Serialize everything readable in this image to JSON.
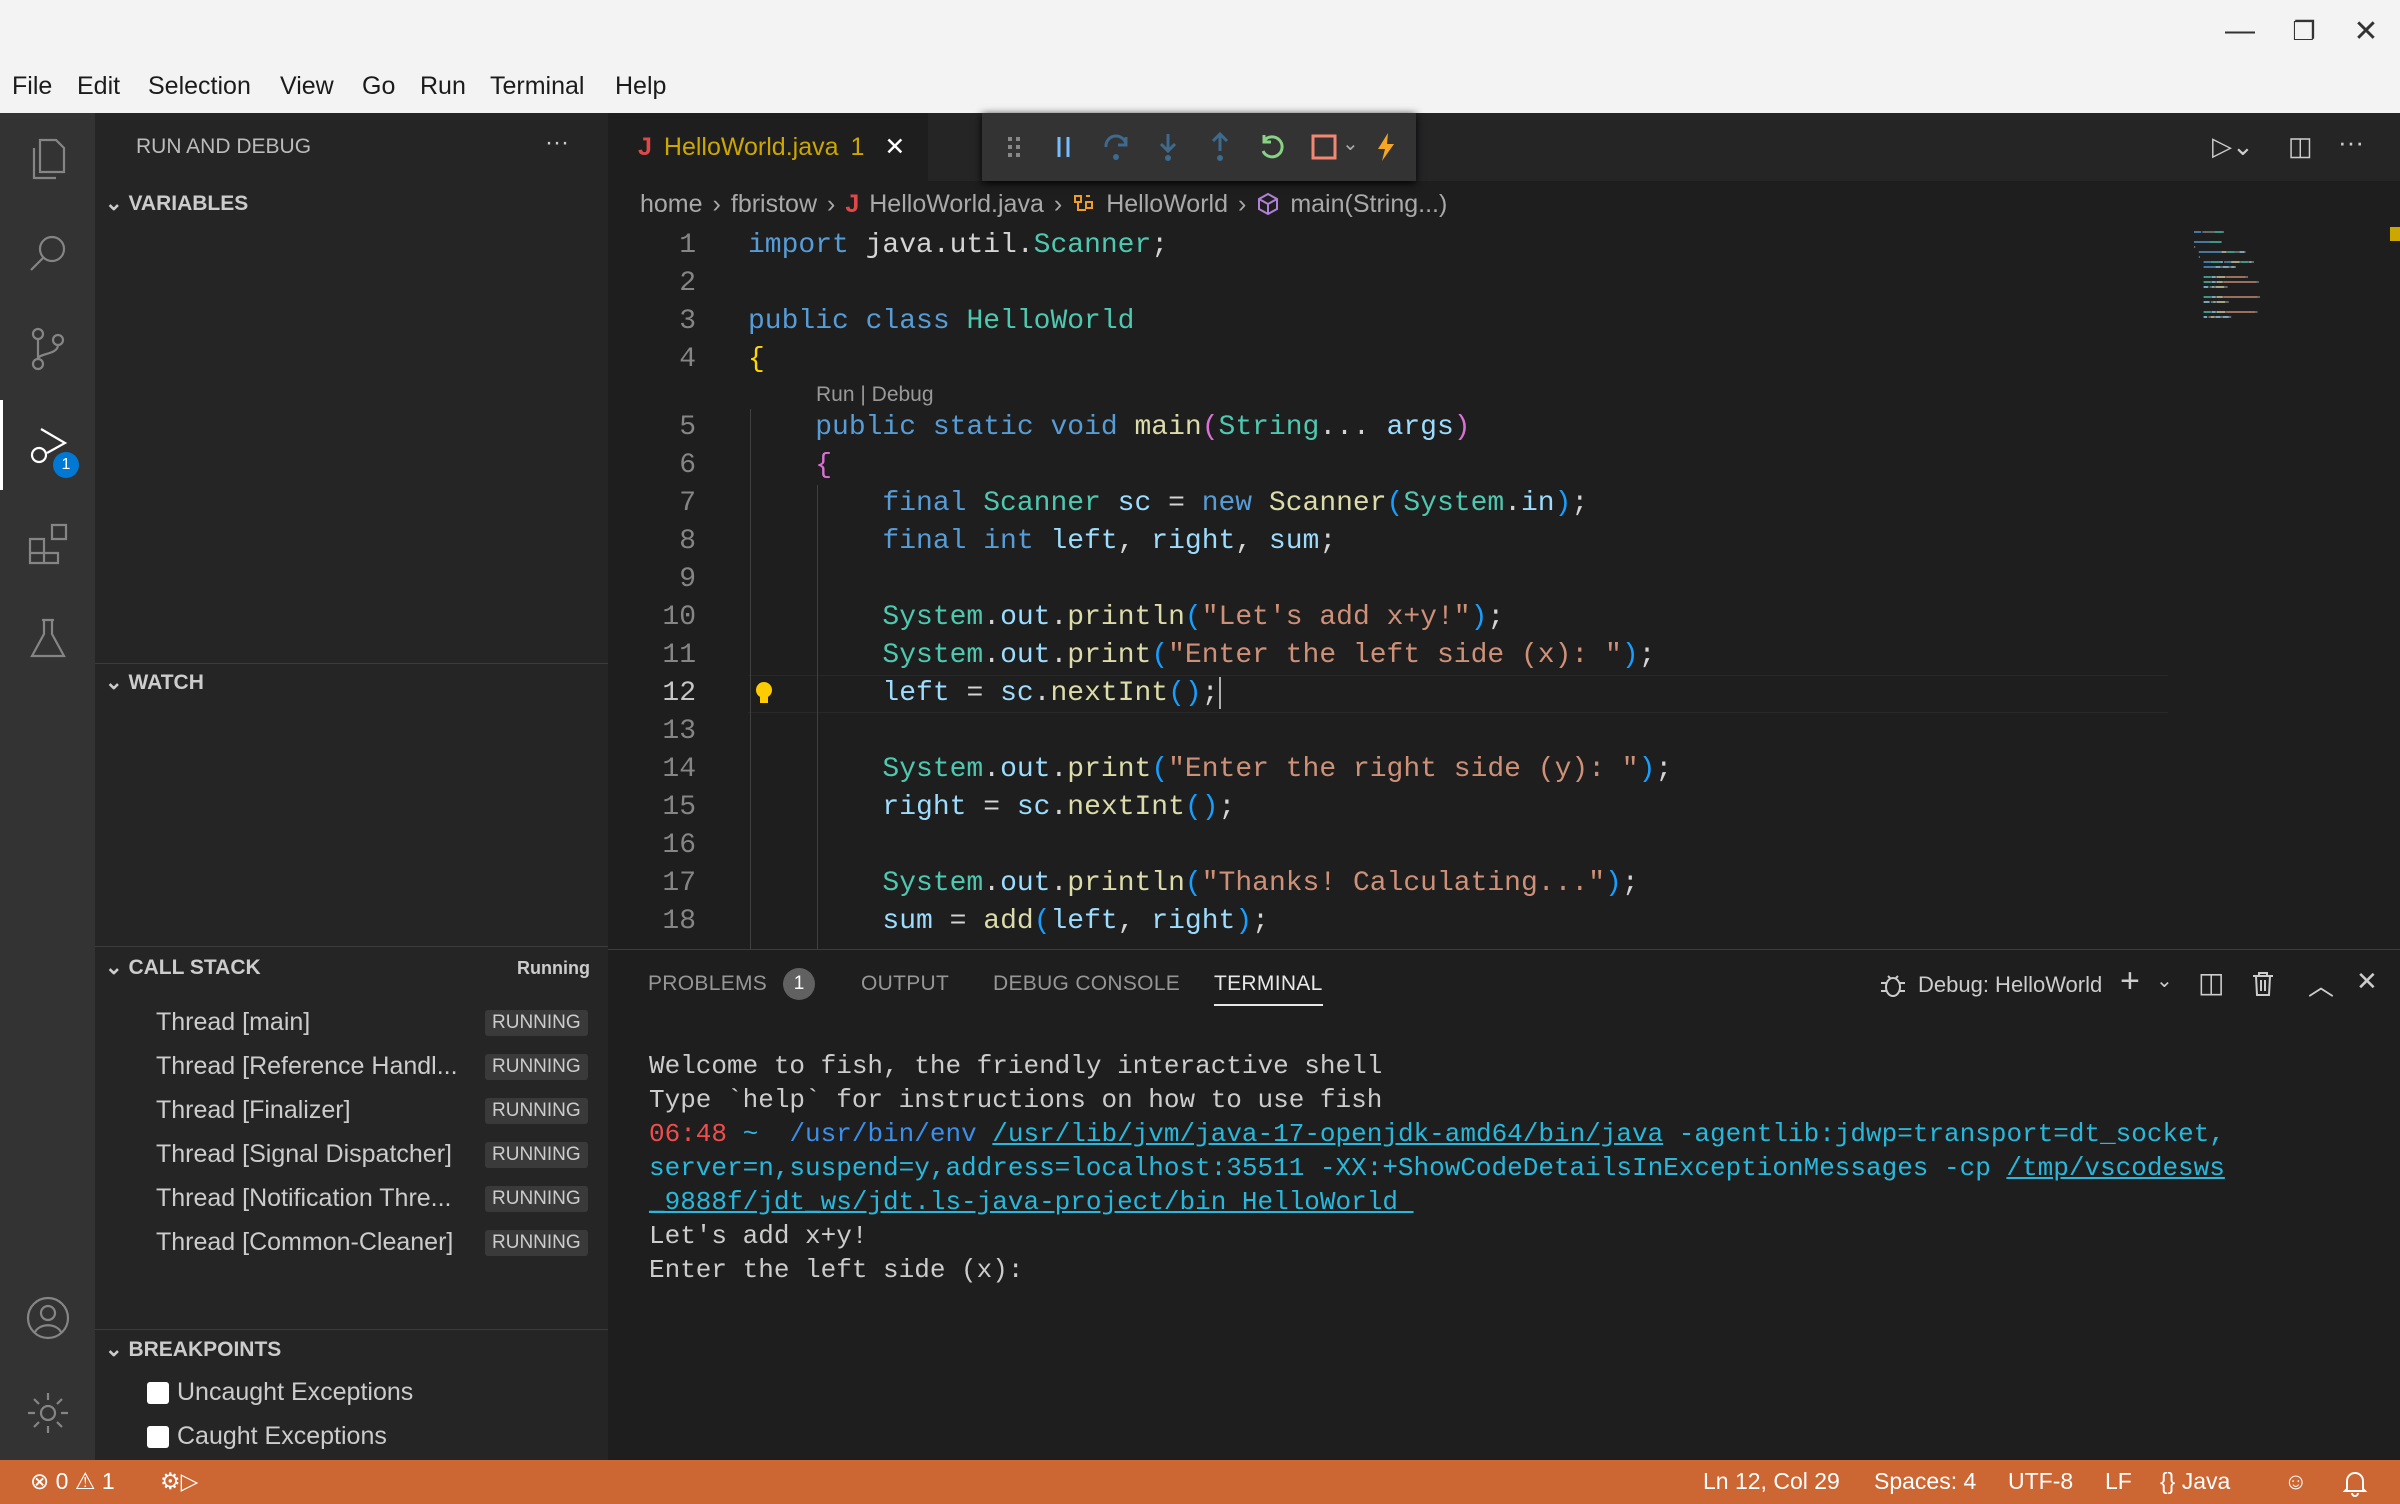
{
  "menu": [
    "File",
    "Edit",
    "Selection",
    "View",
    "Go",
    "Run",
    "Terminal",
    "Help"
  ],
  "activity": {
    "debug_badge": "1"
  },
  "sidebar": {
    "title": "RUN AND DEBUG",
    "more": "···",
    "variables": "VARIABLES",
    "watch": "WATCH",
    "callstack": {
      "label": "CALL STACK",
      "state": "Running",
      "threads": [
        {
          "name": "Thread [main]",
          "state": "RUNNING"
        },
        {
          "name": "Thread [Reference Handl...",
          "state": "RUNNING"
        },
        {
          "name": "Thread [Finalizer]",
          "state": "RUNNING"
        },
        {
          "name": "Thread [Signal Dispatcher]",
          "state": "RUNNING"
        },
        {
          "name": "Thread [Notification Thre...",
          "state": "RUNNING"
        },
        {
          "name": "Thread [Common-Cleaner]",
          "state": "RUNNING"
        }
      ]
    },
    "breakpoints": {
      "label": "BREAKPOINTS",
      "items": [
        {
          "label": "Uncaught Exceptions",
          "checked": false
        },
        {
          "label": "Caught Exceptions",
          "checked": false
        }
      ]
    }
  },
  "tab": {
    "icon": "J",
    "name": "HelloWorld.java",
    "problems": "1"
  },
  "breadcrumb": [
    "home",
    "fbristow",
    "HelloWorld.java",
    "HelloWorld",
    "main(String...)"
  ],
  "codelens": "Run | Debug",
  "code": [
    {
      "n": "1",
      "t": [
        [
          "import",
          "kw"
        ],
        [
          " java.util.",
          "pu"
        ],
        [
          "Scanner",
          "ty"
        ],
        [
          ";",
          "pu"
        ]
      ]
    },
    {
      "n": "2",
      "t": []
    },
    {
      "n": "3",
      "t": [
        [
          "public class ",
          "kw"
        ],
        [
          "HelloWorld",
          "ty"
        ]
      ]
    },
    {
      "n": "4",
      "t": [
        [
          "{",
          "b1"
        ]
      ]
    },
    {
      "n": "5",
      "t": [
        [
          "    public static void ",
          "kw"
        ],
        [
          "main",
          "fn"
        ],
        [
          "(",
          "b2"
        ],
        [
          "String",
          "ty"
        ],
        [
          "... ",
          "pu"
        ],
        [
          "args",
          "va"
        ],
        [
          ")",
          "b2"
        ]
      ]
    },
    {
      "n": "6",
      "t": [
        [
          "    ",
          "pu"
        ],
        [
          "{",
          "b2"
        ]
      ]
    },
    {
      "n": "7",
      "t": [
        [
          "        final ",
          "kw"
        ],
        [
          "Scanner ",
          "ty"
        ],
        [
          "sc",
          "va"
        ],
        [
          " = ",
          "pu"
        ],
        [
          "new ",
          "kw"
        ],
        [
          "Scanner",
          "fn"
        ],
        [
          "(",
          "b3"
        ],
        [
          "System",
          "ty"
        ],
        [
          ".",
          "pu"
        ],
        [
          "in",
          "va"
        ],
        [
          ")",
          "b3"
        ],
        [
          ";",
          "pu"
        ]
      ]
    },
    {
      "n": "8",
      "t": [
        [
          "        final int ",
          "kw"
        ],
        [
          "left",
          "va"
        ],
        [
          ", ",
          "pu"
        ],
        [
          "right",
          "va"
        ],
        [
          ", ",
          "pu"
        ],
        [
          "sum",
          "va"
        ],
        [
          ";",
          "pu"
        ]
      ]
    },
    {
      "n": "9",
      "t": []
    },
    {
      "n": "10",
      "t": [
        [
          "        System",
          "ty"
        ],
        [
          ".",
          "pu"
        ],
        [
          "out",
          "va"
        ],
        [
          ".",
          "pu"
        ],
        [
          "println",
          "fn"
        ],
        [
          "(",
          "b3"
        ],
        [
          "\"Let's add x+y!\"",
          "st"
        ],
        [
          ")",
          "b3"
        ],
        [
          ";",
          "pu"
        ]
      ]
    },
    {
      "n": "11",
      "t": [
        [
          "        System",
          "ty"
        ],
        [
          ".",
          "pu"
        ],
        [
          "out",
          "va"
        ],
        [
          ".",
          "pu"
        ],
        [
          "print",
          "fn"
        ],
        [
          "(",
          "b3"
        ],
        [
          "\"Enter the left side (x): \"",
          "st"
        ],
        [
          ")",
          "b3"
        ],
        [
          ";",
          "pu"
        ]
      ]
    },
    {
      "n": "12",
      "t": [
        [
          "        left",
          "va"
        ],
        [
          " = ",
          "pu"
        ],
        [
          "sc",
          "va"
        ],
        [
          ".",
          "pu"
        ],
        [
          "nextInt",
          "fn"
        ],
        [
          "(",
          "b3"
        ],
        [
          ")",
          "b3"
        ],
        [
          ";",
          "pu"
        ]
      ]
    },
    {
      "n": "13",
      "t": []
    },
    {
      "n": "14",
      "t": [
        [
          "        System",
          "ty"
        ],
        [
          ".",
          "pu"
        ],
        [
          "out",
          "va"
        ],
        [
          ".",
          "pu"
        ],
        [
          "print",
          "fn"
        ],
        [
          "(",
          "b3"
        ],
        [
          "\"Enter the right side (y): \"",
          "st"
        ],
        [
          ")",
          "b3"
        ],
        [
          ";",
          "pu"
        ]
      ]
    },
    {
      "n": "15",
      "t": [
        [
          "        right",
          "va"
        ],
        [
          " = ",
          "pu"
        ],
        [
          "sc",
          "va"
        ],
        [
          ".",
          "pu"
        ],
        [
          "nextInt",
          "fn"
        ],
        [
          "(",
          "b3"
        ],
        [
          ")",
          "b3"
        ],
        [
          ";",
          "pu"
        ]
      ]
    },
    {
      "n": "16",
      "t": []
    },
    {
      "n": "17",
      "t": [
        [
          "        System",
          "ty"
        ],
        [
          ".",
          "pu"
        ],
        [
          "out",
          "va"
        ],
        [
          ".",
          "pu"
        ],
        [
          "println",
          "fn"
        ],
        [
          "(",
          "b3"
        ],
        [
          "\"Thanks! Calculating...\"",
          "st"
        ],
        [
          ")",
          "b3"
        ],
        [
          ";",
          "pu"
        ]
      ]
    },
    {
      "n": "18",
      "t": [
        [
          "        sum",
          "va"
        ],
        [
          " = ",
          "pu"
        ],
        [
          "add",
          "fn"
        ],
        [
          "(",
          "b3"
        ],
        [
          "left",
          "va"
        ],
        [
          ", ",
          "pu"
        ],
        [
          "right",
          "va"
        ],
        [
          ")",
          "b3"
        ],
        [
          ";",
          "pu"
        ]
      ]
    }
  ],
  "current_line": "12",
  "panel": {
    "tabs": [
      "PROBLEMS",
      "OUTPUT",
      "DEBUG CONSOLE",
      "TERMINAL"
    ],
    "problems_count": "1",
    "active": "TERMINAL",
    "session": "Debug: HelloWorld"
  },
  "terminal": [
    [
      [
        "Welcome to fish, the friendly interactive shell",
        "#cccccc",
        false
      ]
    ],
    [
      [
        "Type `help` for instructions on how to use fish",
        "#cccccc",
        false
      ]
    ],
    [
      [
        "06:48",
        "#f14c4c",
        false
      ],
      [
        " ~  ",
        "#29b8db",
        false
      ],
      [
        "/usr/bin/env",
        "#3b8eea",
        false
      ],
      [
        " ",
        "#ccc",
        false
      ],
      [
        "/usr/lib/jvm/java-17-openjdk-amd64/bin/java",
        "#29b8db",
        true
      ],
      [
        " -agentlib:jdwp=transport=dt_socket,",
        "#29b8db",
        false
      ]
    ],
    [
      [
        "server=n,suspend=y,address=localhost:35511 -XX:+ShowCodeDetailsInExceptionMessages -cp ",
        "#29b8db",
        false
      ],
      [
        "/tmp/vscodesws",
        "#29b8db",
        true
      ]
    ],
    [
      [
        "_9888f/jdt_ws/jdt.ls-java-project/bin HelloWorld ",
        "#29b8db",
        true
      ]
    ],
    [
      [
        "Let's add x+y!",
        "#cccccc",
        false
      ]
    ],
    [
      [
        "Enter the left side (x):",
        "#cccccc",
        false
      ]
    ]
  ],
  "status": {
    "errors": "0",
    "warnings": "1",
    "position": "Ln 12, Col 29",
    "spaces": "Spaces: 4",
    "encoding": "UTF-8",
    "eol": "LF",
    "language": "Java",
    "color": "#cc6633"
  }
}
